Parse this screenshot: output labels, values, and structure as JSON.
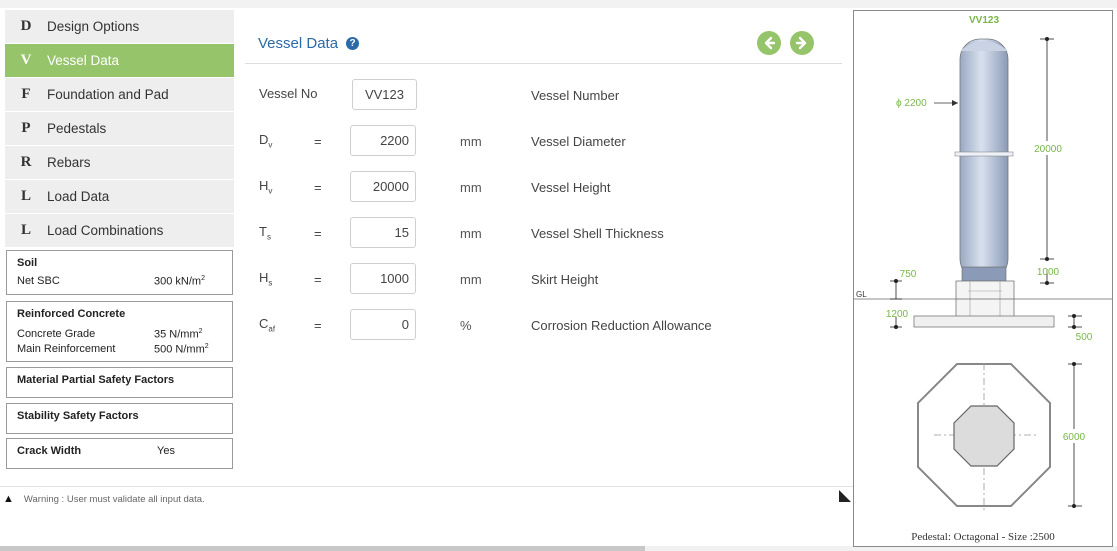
{
  "sidebar": {
    "items": [
      {
        "letter": "D",
        "label": "Design Options"
      },
      {
        "letter": "V",
        "label": "Vessel Data"
      },
      {
        "letter": "F",
        "label": "Foundation and Pad"
      },
      {
        "letter": "P",
        "label": "Pedestals"
      },
      {
        "letter": "R",
        "label": "Rebars"
      },
      {
        "letter": "L",
        "label": "Load Data"
      },
      {
        "letter": "L",
        "label": "Load Combinations"
      }
    ],
    "active_index": 1,
    "active_color": "#96c46b",
    "soil": {
      "title": "Soil",
      "key": "Net SBC",
      "value": "300 kN/m",
      "sup": "2"
    },
    "concrete": {
      "title": "Reinforced Concrete",
      "grade_key": "Concrete Grade",
      "grade_value": "35 N/mm",
      "grade_sup": "2",
      "reinf_key": "Main Reinforcement",
      "reinf_value": "500 N/mm",
      "reinf_sup": "2"
    },
    "material_factors": "Material Partial Safety Factors",
    "stability_factors": "Stability Safety Factors",
    "crack": {
      "title": "Crack Width",
      "value": "Yes"
    }
  },
  "main": {
    "title": "Vessel Data",
    "help_icon": "question-circle-icon",
    "fields": [
      {
        "sym": "Vessel No",
        "sub": "",
        "eq": "",
        "value": "VV123",
        "unit": "",
        "desc": "Vessel Number"
      },
      {
        "sym": "D",
        "sub": "v",
        "eq": "=",
        "value": "2200",
        "unit": "mm",
        "desc": "Vessel Diameter"
      },
      {
        "sym": "H",
        "sub": "v",
        "eq": "=",
        "value": "20000",
        "unit": "mm",
        "desc": "Vessel Height"
      },
      {
        "sym": "T",
        "sub": "s",
        "eq": "=",
        "value": "15",
        "unit": "mm",
        "desc": "Vessel Shell Thickness"
      },
      {
        "sym": "H",
        "sub": "s",
        "eq": "=",
        "value": "1000",
        "unit": "mm",
        "desc": "Skirt Height"
      },
      {
        "sym": "C",
        "sub": "af",
        "eq": "=",
        "value": "0",
        "unit": "%",
        "desc": "Corrosion Reduction Allowance"
      }
    ]
  },
  "warning": "Warning : User must validate all input data.",
  "drawing": {
    "vessel_label": "VV123",
    "diameter": "ϕ 2200",
    "height": "20000",
    "skirt": "1000",
    "pedestal_height": "750",
    "gl": "GL",
    "pad_depth": "1200",
    "pad_thickness": "500",
    "footing_size": "6000",
    "caption": "Pedestal: Octagonal - Size :2500",
    "accent": "#7ab648"
  }
}
